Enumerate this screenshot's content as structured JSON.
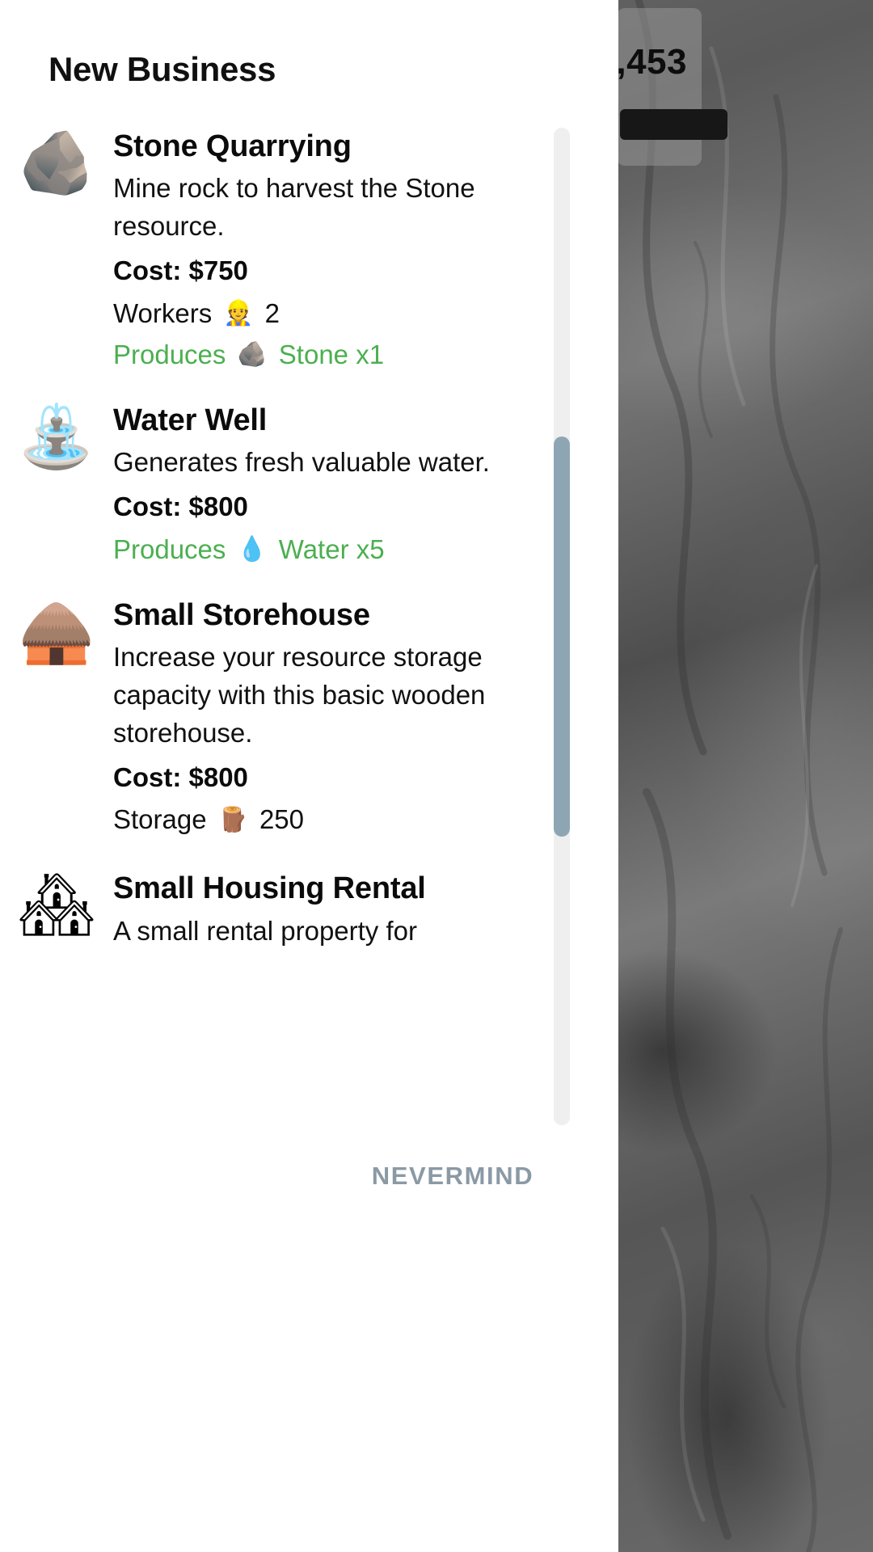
{
  "background": {
    "hud": {
      "money_text": ",453",
      "button_label": ""
    }
  },
  "dialog": {
    "title": "New Business",
    "nevermind_label": "NEVERMIND",
    "accent_green": "#4CAF50",
    "nevermind_color": "#8a9aa5",
    "businesses": [
      {
        "icon": "🪨",
        "icon_name": "stone-quarry-icon",
        "name": "Stone Quarrying",
        "description": "Mine rock to harvest the Stone resource.",
        "cost": "Cost: $750",
        "stat_label": "Workers",
        "stat_icon": "👷",
        "stat_icon_name": "worker-icon",
        "stat_value": "2",
        "produces_label": "Produces",
        "produces_icon": "🪨",
        "produces_icon_name": "stone-resource-icon",
        "produces_value": "Stone x1"
      },
      {
        "icon": "⛲",
        "icon_name": "water-well-icon",
        "name": "Water Well",
        "description": "Generates fresh valuable water.",
        "cost": "Cost: $800",
        "stat_label": "",
        "stat_icon": "",
        "stat_icon_name": "",
        "stat_value": "",
        "produces_label": "Produces",
        "produces_icon": "💧",
        "produces_icon_name": "water-drop-icon",
        "produces_value": "Water x5"
      },
      {
        "icon": "🛖",
        "icon_name": "small-storehouse-icon",
        "name": "Small Storehouse",
        "description": "Increase your resource storage capacity with this basic wooden storehouse.",
        "cost": "Cost: $800",
        "stat_label": "Storage",
        "stat_icon": "🪵",
        "stat_icon_name": "wood-storage-icon",
        "stat_value": "250",
        "produces_label": "",
        "produces_icon": "",
        "produces_icon_name": "",
        "produces_value": ""
      },
      {
        "icon": "🏘",
        "icon_name": "small-housing-rental-icon",
        "name": "Small Housing Rental",
        "description": "A small rental property for",
        "cost": "",
        "stat_label": "",
        "stat_icon": "",
        "stat_icon_name": "",
        "stat_value": "",
        "produces_label": "",
        "produces_icon": "",
        "produces_icon_name": "",
        "produces_value": ""
      }
    ]
  }
}
